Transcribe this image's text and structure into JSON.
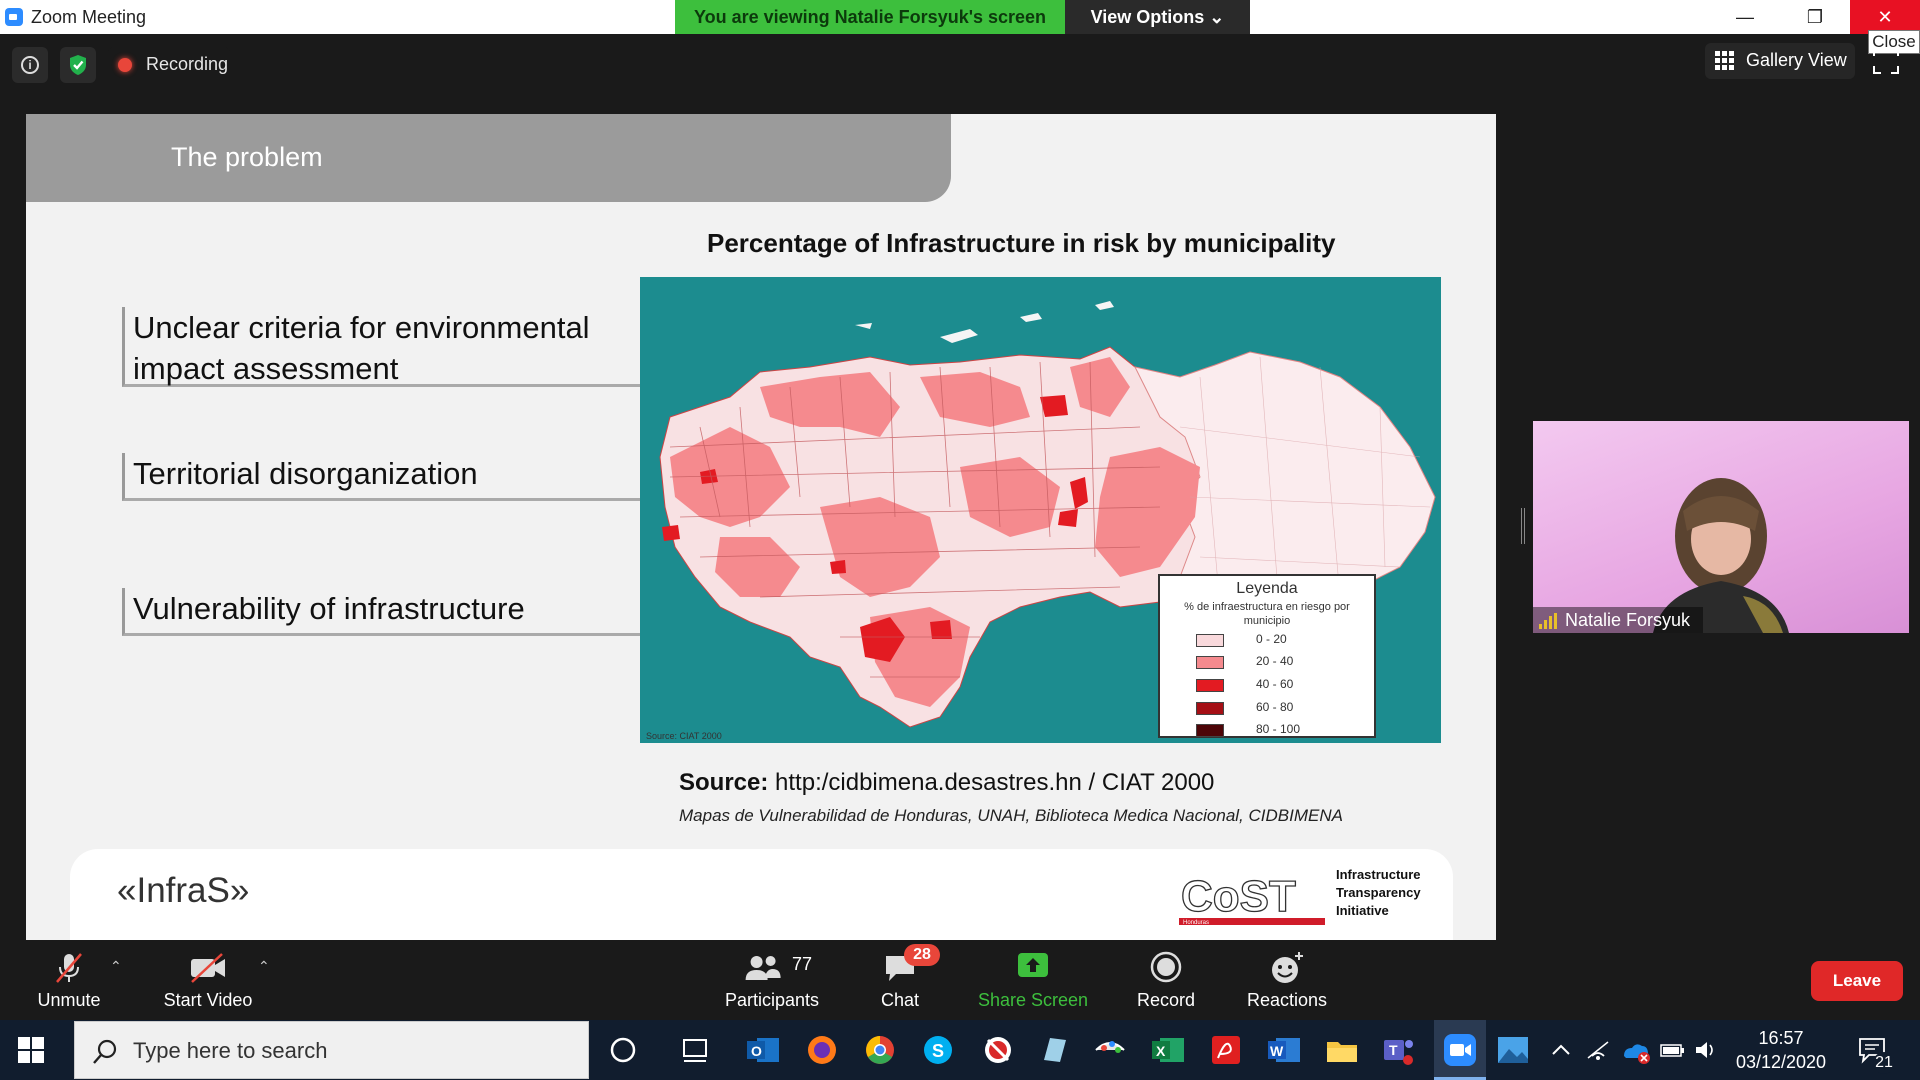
{
  "window": {
    "title": "Zoom Meeting",
    "viewing_banner": "You are viewing Natalie Forsyuk's screen",
    "view_options": "View Options ⌄",
    "minimize": "—",
    "maximize": "❐",
    "close": "✕",
    "close_tooltip": "Close"
  },
  "meeting_bar": {
    "recording_label": "Recording",
    "gallery_view": "Gallery View"
  },
  "slide": {
    "header_title": "The problem",
    "bullets": [
      "Unclear criteria for environmental impact assessment",
      "Territorial disorganization",
      "Vulnerability of  infrastructure"
    ],
    "map_title": "Percentage of Infrastructure in risk by municipality",
    "map_source_small": "Source:  CIAT 2000",
    "legend": {
      "title": "Leyenda",
      "subtitle": "% de infraestructura en riesgo por municipio",
      "ranges": [
        "0 - 20",
        "20 - 40",
        "40 - 60",
        "60 - 80",
        "80 - 100"
      ],
      "colors": [
        "#f9d9dc",
        "#f58a8e",
        "#e31b22",
        "#a50f15",
        "#4d0508"
      ]
    },
    "source_label": "Source:",
    "source_text": "http:/cidbimena.desastres.hn / CIAT 2000",
    "citation": "Mapas de Vulnerabilidad de Honduras, UNAH, Biblioteca Medica Nacional, CIDBIMENA",
    "footer_left": "«InfraS»",
    "cost_logo_text": "CoST",
    "cost_logo_sub": "Honduras",
    "cost_tagline": [
      "Infrastructure",
      "Transparency",
      "Initiative"
    ]
  },
  "participant_video": {
    "name": "Natalie Forsyuk"
  },
  "toolbar": {
    "unmute": "Unmute",
    "start_video": "Start Video",
    "participants": "Participants",
    "participants_count": "77",
    "chat": "Chat",
    "chat_badge": "28",
    "share_screen": "Share Screen",
    "record": "Record",
    "reactions": "Reactions",
    "leave": "Leave",
    "caret": "⌃"
  },
  "taskbar": {
    "search_placeholder": "Type here to search",
    "time": "16:57",
    "date": "03/12/2020",
    "notification_count": "21"
  },
  "colors": {
    "share_green": "#3dbf3d",
    "leave_red": "#e02828",
    "map_sea": "#1c8c8f"
  }
}
